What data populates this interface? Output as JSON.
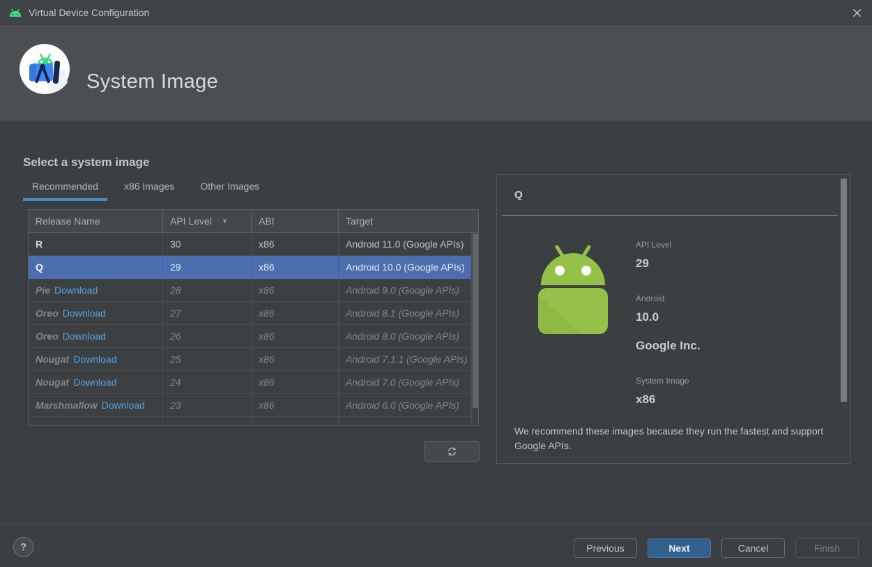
{
  "window": {
    "title": "Virtual Device Configuration"
  },
  "icons": {
    "close": "✕",
    "sort_desc": "▼",
    "help": "?"
  },
  "header": {
    "title": "System Image"
  },
  "main": {
    "heading": "Select a system image",
    "tabs": [
      {
        "label": "Recommended",
        "active": true
      },
      {
        "label": "x86 Images",
        "active": false
      },
      {
        "label": "Other Images",
        "active": false
      }
    ],
    "table": {
      "columns": [
        {
          "label": "Release Name"
        },
        {
          "label": "API Level",
          "sorted": "desc"
        },
        {
          "label": "ABI"
        },
        {
          "label": "Target"
        }
      ],
      "rows": [
        {
          "name": "R",
          "api": "30",
          "abi": "x86",
          "target": "Android 11.0 (Google APIs)",
          "installed": true,
          "selected": false
        },
        {
          "name": "Q",
          "api": "29",
          "abi": "x86",
          "target": "Android 10.0 (Google APIs)",
          "installed": true,
          "selected": true
        },
        {
          "name": "Pie",
          "download_label": "Download",
          "api": "28",
          "abi": "x86",
          "target": "Android 9.0 (Google APIs)",
          "installed": false,
          "selected": false
        },
        {
          "name": "Oreo",
          "download_label": "Download",
          "api": "27",
          "abi": "x86",
          "target": "Android 8.1 (Google APIs)",
          "installed": false,
          "selected": false
        },
        {
          "name": "Oreo",
          "download_label": "Download",
          "api": "26",
          "abi": "x86",
          "target": "Android 8.0 (Google APIs)",
          "installed": false,
          "selected": false
        },
        {
          "name": "Nougat",
          "download_label": "Download",
          "api": "25",
          "abi": "x86",
          "target": "Android 7.1.1 (Google APIs)",
          "installed": false,
          "selected": false
        },
        {
          "name": "Nougat",
          "download_label": "Download",
          "api": "24",
          "abi": "x86",
          "target": "Android 7.0 (Google APIs)",
          "installed": false,
          "selected": false
        },
        {
          "name": "Marshmallow",
          "download_label": "Download",
          "api": "23",
          "abi": "x86",
          "target": "Android 6.0 (Google APIs)",
          "installed": false,
          "selected": false
        }
      ]
    }
  },
  "details": {
    "title": "Q",
    "groups": [
      {
        "label": "API Level",
        "values": [
          "29"
        ]
      },
      {
        "label": "Android",
        "values": [
          "10.0",
          "Google Inc."
        ]
      },
      {
        "label": "System Image",
        "values": [
          "x86"
        ]
      }
    ],
    "note": "We recommend these images because they run the fastest and support Google APIs."
  },
  "footer": {
    "buttons": [
      {
        "label": "Previous",
        "style": "normal",
        "enabled": true
      },
      {
        "label": "Next",
        "style": "primary",
        "enabled": true
      },
      {
        "label": "Cancel",
        "style": "normal",
        "enabled": true
      },
      {
        "label": "Finish",
        "style": "normal",
        "enabled": false
      }
    ]
  },
  "colors": {
    "selection_blue": "#4b6eae",
    "tab_accent_blue": "#4886c8",
    "link_blue": "#58a0dc",
    "primary_button_blue": "#32618e",
    "android_green": "#94c147",
    "android_brand_green": "#3ddc84"
  }
}
